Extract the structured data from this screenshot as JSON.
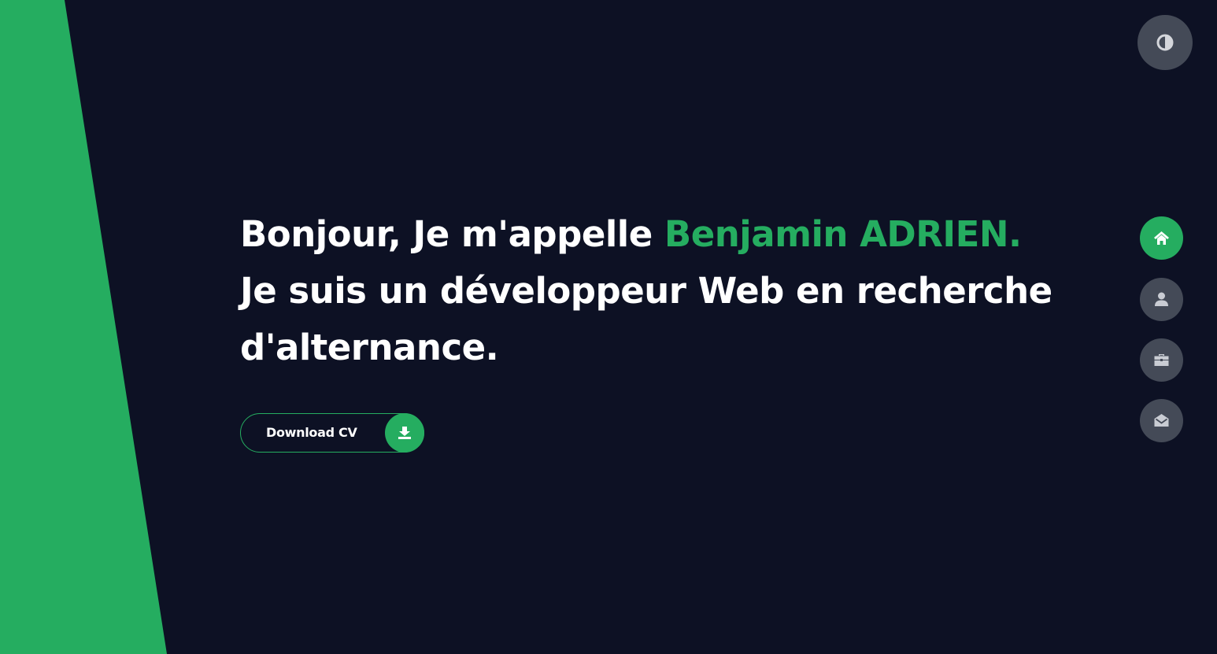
{
  "hero": {
    "greeting": "Bonjour, Je m'appelle ",
    "name": "Benjamin ADRIEN.",
    "line_two": "Je suis un développeur Web en recherche",
    "line_three": "d'alternance."
  },
  "cta": {
    "label": "Download CV",
    "icon": "download-icon"
  },
  "theme_toggle": {
    "icon": "contrast-icon"
  },
  "navigation": [
    {
      "id": "home",
      "icon": "home-icon",
      "active": true
    },
    {
      "id": "about",
      "icon": "user-icon",
      "active": false
    },
    {
      "id": "portfolio",
      "icon": "briefcase-icon",
      "active": false
    },
    {
      "id": "contact",
      "icon": "envelope-open-icon",
      "active": false
    }
  ],
  "colors": {
    "background": "#0d1124",
    "accent": "#25ad60",
    "nav_inactive": "#444a57",
    "nav_icon": "#c9ccd3",
    "text": "#ffffff"
  }
}
